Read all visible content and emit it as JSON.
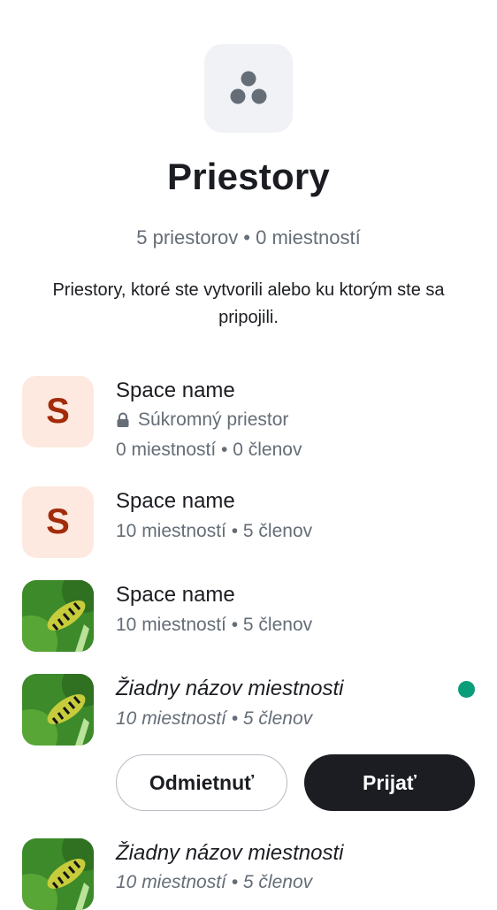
{
  "header": {
    "icon": "spaces-icon",
    "title": "Priestory",
    "summary": "5 priestorov • 0 miestností",
    "description": "Priestory, ktoré ste vytvorili alebo ku ktorým ste sa pripojili."
  },
  "spaces": [
    {
      "avatar_letter": "S",
      "name": "Space name",
      "privacy": "Súkromný priestor",
      "meta": "0 miestností • 0 členov"
    },
    {
      "avatar_letter": "S",
      "name": "Space name",
      "meta": "10 miestností • 5 členov"
    },
    {
      "avatar": "caterpillar-photo",
      "name": "Space name",
      "meta": "10 miestností • 5 členov"
    },
    {
      "avatar": "caterpillar-photo",
      "name": "Žiadny názov miestnosti",
      "meta": "10 miestností • 5 členov",
      "invite": true
    },
    {
      "avatar": "caterpillar-photo",
      "name": "Žiadny názov miestnosti",
      "meta": "10 miestností • 5 členov"
    }
  ],
  "invite_actions": {
    "decline": "Odmietnuť",
    "accept": "Prijať"
  },
  "colors": {
    "accent_dot": "#0a9d7a",
    "letter_avatar_bg": "#fde9df",
    "letter_avatar_fg": "#a22b0a"
  }
}
